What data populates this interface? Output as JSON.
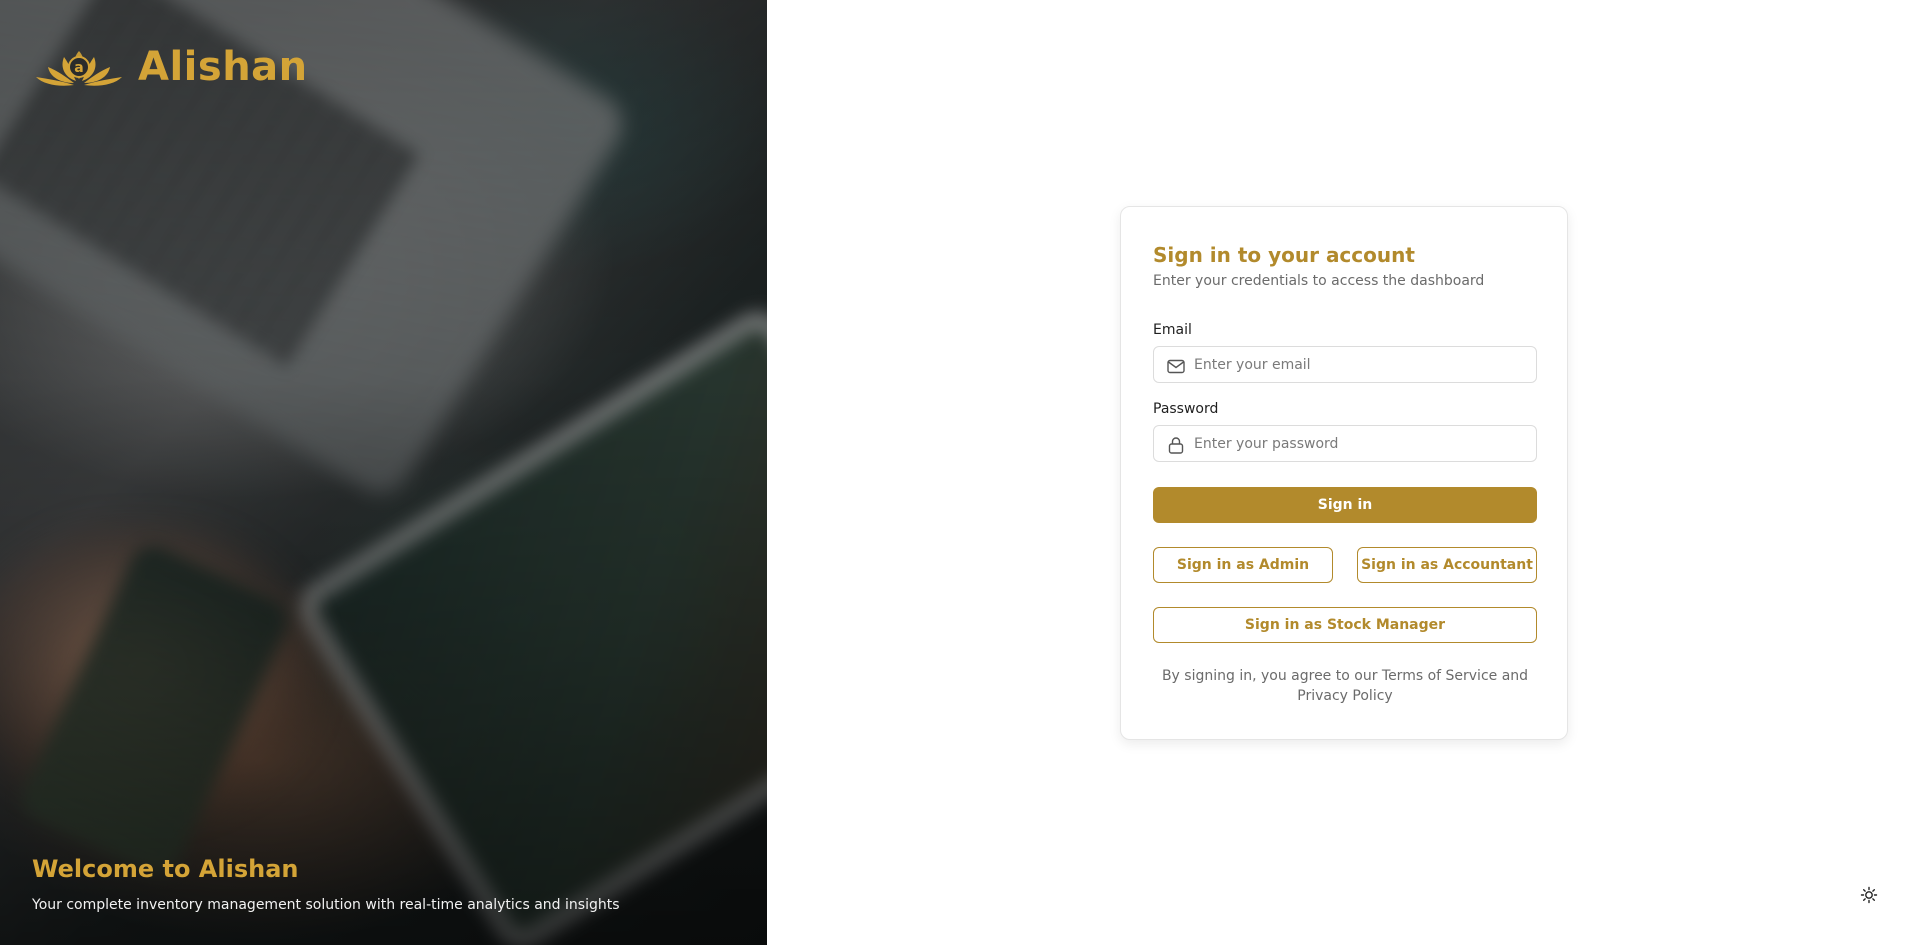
{
  "brand": {
    "name": "Alishan"
  },
  "hero": {
    "title": "Welcome to Alishan",
    "subtitle": "Your complete inventory management solution with real-time analytics and insights"
  },
  "login": {
    "title": "Sign in to your account",
    "subtitle": "Enter your credentials to access the dashboard",
    "email": {
      "label": "Email",
      "placeholder": "Enter your email",
      "value": "",
      "icon": "mail-icon"
    },
    "password": {
      "label": "Password",
      "placeholder": "Enter your password",
      "value": "",
      "icon": "lock-icon"
    },
    "sign_in_label": "Sign in",
    "admin_label": "Sign in as Admin",
    "accountant_label": "Sign in as Accountant",
    "stock_manager_label": "Sign in as Stock Manager",
    "terms": "By signing in, you agree to our Terms of Service and Privacy Policy"
  },
  "theme": {
    "icon": "sun-icon"
  },
  "colors": {
    "accent": "#b28a2c",
    "brand_gold": "#d4a437",
    "muted_text": "#6b6b6b"
  }
}
